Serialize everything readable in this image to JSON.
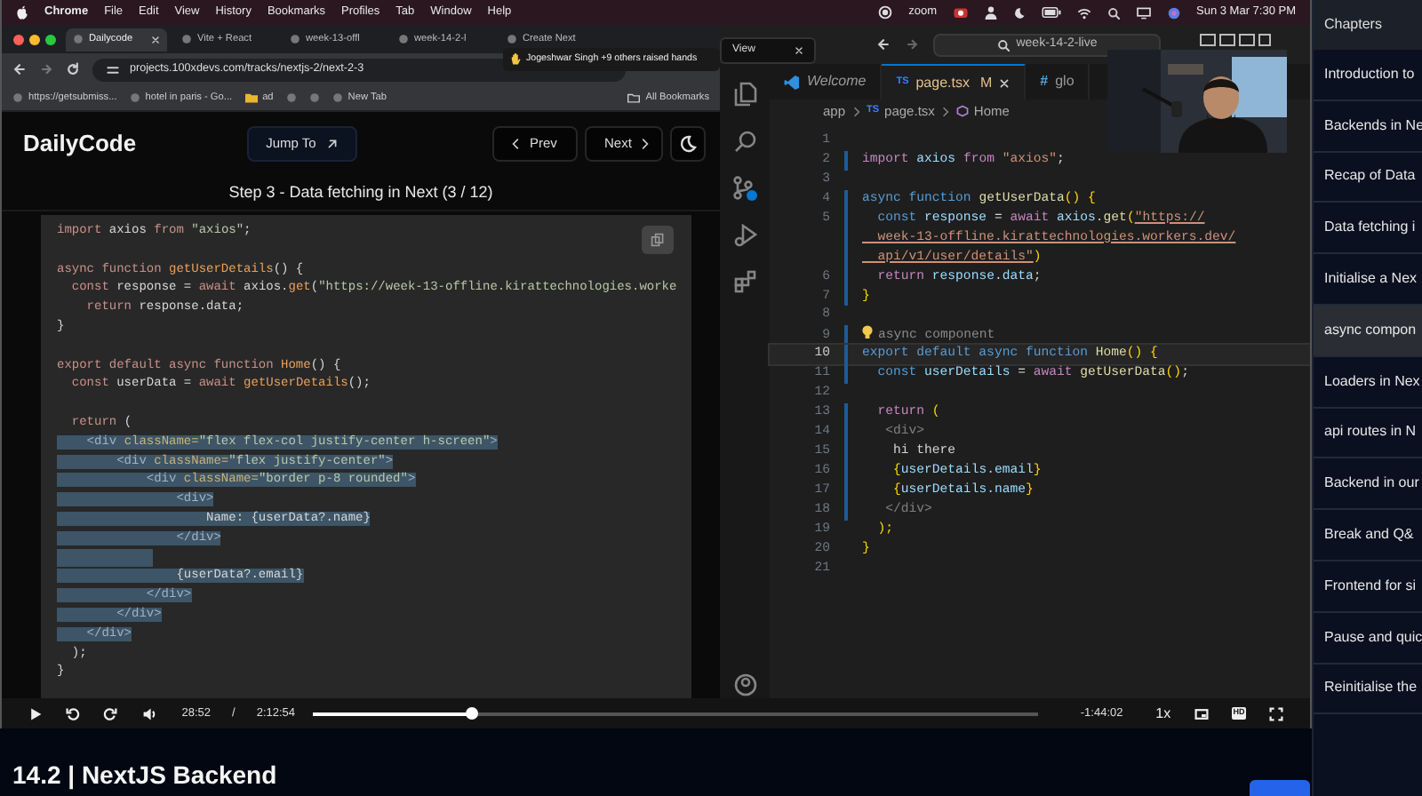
{
  "menubar": {
    "items": [
      "Chrome",
      "File",
      "Edit",
      "View",
      "History",
      "Bookmarks",
      "Profiles",
      "Tab",
      "Window",
      "Help"
    ],
    "app_label": "zoom",
    "clock": "Sun 3 Mar 7:30 PM"
  },
  "browser": {
    "tabs": [
      {
        "label": "Dailycode",
        "selected": true
      },
      {
        "label": "Vite + React",
        "selected": false
      },
      {
        "label": "week-13-offl",
        "selected": false
      },
      {
        "label": "week-14-2-l",
        "selected": false
      },
      {
        "label": "Create Next",
        "selected": false
      }
    ],
    "address": "projects.100xdevs.com/tracks/nextjs-2/next-2-3",
    "bookmarks": [
      {
        "kind": "link",
        "label": "https://getsubmiss..."
      },
      {
        "kind": "link",
        "label": "hotel in paris - Go..."
      },
      {
        "kind": "folder",
        "label": "ad"
      },
      {
        "kind": "icon"
      },
      {
        "kind": "icon"
      },
      {
        "kind": "link",
        "label": "New Tab"
      }
    ],
    "all_bookmarks": "All Bookmarks",
    "notification": "Jogeshwar Singh +9 others raised hands",
    "site": {
      "brand": "DailyCode",
      "jump": "Jump To",
      "prev": "Prev",
      "next": "Next",
      "step": "Step 3 - Data fetching in Next (3 / 12)"
    },
    "code": [
      {
        "selected": false,
        "tokens": [
          {
            "kind": "kw",
            "text": "import "
          },
          {
            "kind": "p",
            "text": "axios "
          },
          {
            "kind": "kw",
            "text": "from "
          },
          {
            "kind": "s",
            "text": "\"axios\""
          },
          {
            "kind": "p",
            "text": ";"
          }
        ]
      },
      {
        "selected": false
      },
      {
        "selected": false,
        "tokens": [
          {
            "kind": "kw",
            "text": "async function "
          },
          {
            "kind": "f",
            "text": "getUserDetails"
          },
          {
            "kind": "p",
            "text": "() {"
          }
        ]
      },
      {
        "selected": false,
        "tokens": [
          {
            "kind": "kw",
            "text": "  const "
          },
          {
            "kind": "p",
            "text": "response = "
          },
          {
            "kind": "kw",
            "text": "await "
          },
          {
            "kind": "p",
            "text": "axios."
          },
          {
            "kind": "f",
            "text": "get"
          },
          {
            "kind": "p",
            "text": "("
          },
          {
            "kind": "s",
            "text": "\"https://week-13-offline.kirattechnologies.worke"
          }
        ]
      },
      {
        "selected": false,
        "tokens": [
          {
            "kind": "kw",
            "text": "    return "
          },
          {
            "kind": "p",
            "text": "response.data;"
          }
        ]
      },
      {
        "selected": false,
        "tokens": [
          {
            "kind": "p",
            "text": "}"
          }
        ]
      },
      {
        "selected": false
      },
      {
        "selected": false,
        "tokens": [
          {
            "kind": "kw",
            "text": "export default async function "
          },
          {
            "kind": "f",
            "text": "Home"
          },
          {
            "kind": "p",
            "text": "() {"
          }
        ]
      },
      {
        "selected": false,
        "tokens": [
          {
            "kind": "kw",
            "text": "  const "
          },
          {
            "kind": "p",
            "text": "userData = "
          },
          {
            "kind": "kw",
            "text": "await "
          },
          {
            "kind": "f",
            "text": "getUserDetails"
          },
          {
            "kind": "p",
            "text": "();"
          }
        ]
      },
      {
        "selected": false
      },
      {
        "selected": false,
        "tokens": [
          {
            "kind": "kw",
            "text": "  return "
          },
          {
            "kind": "p",
            "text": "("
          }
        ]
      },
      {
        "selected": true,
        "tokens": [
          {
            "kind": "t",
            "text": "    <div "
          },
          {
            "kind": "a",
            "text": "className="
          },
          {
            "kind": "s",
            "text": "\"flex flex-col justify-center h-screen\""
          },
          {
            "kind": "t",
            "text": ">"
          }
        ]
      },
      {
        "selected": true,
        "tokens": [
          {
            "kind": "t",
            "text": "        <div "
          },
          {
            "kind": "a",
            "text": "className="
          },
          {
            "kind": "s",
            "text": "\"flex justify-center\""
          },
          {
            "kind": "t",
            "text": ">"
          }
        ]
      },
      {
        "selected": true,
        "tokens": [
          {
            "kind": "t",
            "text": "            <div "
          },
          {
            "kind": "a",
            "text": "className="
          },
          {
            "kind": "s",
            "text": "\"border p-8 rounded\""
          },
          {
            "kind": "t",
            "text": ">"
          }
        ]
      },
      {
        "selected": true,
        "tokens": [
          {
            "kind": "t",
            "text": "                <div>"
          }
        ]
      },
      {
        "selected": true,
        "tokens": [
          {
            "kind": "p",
            "text": "                    Name: {userData?.name}"
          }
        ]
      },
      {
        "selected": true,
        "tokens": [
          {
            "kind": "t",
            "text": "                </div>"
          }
        ]
      },
      {
        "selected": true
      },
      {
        "selected": true,
        "tokens": [
          {
            "kind": "p",
            "text": "                {userData?.email}"
          }
        ]
      },
      {
        "selected": true,
        "tokens": [
          {
            "kind": "t",
            "text": "            </div>"
          }
        ]
      },
      {
        "selected": true,
        "tokens": [
          {
            "kind": "t",
            "text": "        </div>"
          }
        ]
      },
      {
        "selected": true,
        "tokens": [
          {
            "kind": "t",
            "text": "    </div>"
          }
        ]
      },
      {
        "selected": false,
        "tokens": [
          {
            "kind": "p",
            "text": "  );"
          }
        ]
      },
      {
        "selected": false,
        "tokens": [
          {
            "kind": "p",
            "text": "}"
          }
        ]
      }
    ]
  },
  "vscode": {
    "tooltip": "View",
    "search": "week-14-2-live",
    "tabs": [
      {
        "kind": "welcome",
        "label": "Welcome",
        "selected": false
      },
      {
        "kind": "file",
        "icon_text": "TS",
        "label": "page.tsx",
        "badge": "M",
        "selected": true
      },
      {
        "kind": "file",
        "icon_text": "#",
        "label": "glo",
        "selected": false
      }
    ],
    "breadcrumb": [
      {
        "kind": "folder",
        "label": "app"
      },
      {
        "kind": "file",
        "icon_text": "TS",
        "label": "page.tsx"
      },
      {
        "kind": "symbol",
        "label": "Home"
      }
    ],
    "lines": [
      {
        "n": "1",
        "changed": false,
        "current": false
      },
      {
        "n": "2",
        "changed": true,
        "current": false,
        "tokens": [
          {
            "kind": "ctl",
            "text": "import "
          },
          {
            "kind": "var",
            "text": "axios "
          },
          {
            "kind": "ctl",
            "text": "from "
          },
          {
            "kind": "str",
            "text": "\"axios\""
          },
          {
            "kind": "p",
            "text": ";"
          }
        ]
      },
      {
        "n": "3",
        "changed": false,
        "current": false
      },
      {
        "n": "4",
        "changed": true,
        "current": false,
        "tokens": [
          {
            "kind": "kw",
            "text": "async function "
          },
          {
            "kind": "fn",
            "text": "getUserData"
          },
          {
            "kind": "br",
            "text": "() {"
          }
        ]
      },
      {
        "n": "5",
        "changed": true,
        "current": false,
        "tokens": [
          {
            "kind": "kw",
            "text": "  const "
          },
          {
            "kind": "var",
            "text": "response "
          },
          {
            "kind": "p",
            "text": "= "
          },
          {
            "kind": "ctl",
            "text": "await "
          },
          {
            "kind": "var",
            "text": "axios"
          },
          {
            "kind": "p",
            "text": "."
          },
          {
            "kind": "fn",
            "text": "get"
          },
          {
            "kind": "br",
            "text": "("
          },
          {
            "kind": "url",
            "text": "\"https://"
          }
        ]
      },
      {
        "changed": true,
        "current": false,
        "tokens": [
          {
            "kind": "url",
            "text": "  week-13-offline.kirattechnologies.workers.dev/"
          }
        ]
      },
      {
        "changed": true,
        "current": false,
        "tokens": [
          {
            "kind": "url",
            "text": "  api/v1/user/details\""
          },
          {
            "kind": "br",
            "text": ")"
          }
        ]
      },
      {
        "n": "6",
        "changed": true,
        "current": false,
        "tokens": [
          {
            "kind": "ctl",
            "text": "  return "
          },
          {
            "kind": "var",
            "text": "response"
          },
          {
            "kind": "p",
            "text": "."
          },
          {
            "kind": "var",
            "text": "data"
          },
          {
            "kind": "p",
            "text": ";"
          }
        ]
      },
      {
        "n": "7",
        "changed": true,
        "current": false,
        "tokens": [
          {
            "kind": "br",
            "text": "}"
          }
        ]
      },
      {
        "n": "8",
        "changed": false,
        "current": false
      },
      {
        "n": "9",
        "changed": true,
        "current": false,
        "tokens": [
          {
            "kind": "hint",
            "text": "async component"
          }
        ]
      },
      {
        "n": "10",
        "changed": true,
        "current": true,
        "tokens": [
          {
            "kind": "kw",
            "text": "export default async function "
          },
          {
            "kind": "fn",
            "text": "Home"
          },
          {
            "kind": "br",
            "text": "() {"
          }
        ]
      },
      {
        "n": "11",
        "changed": true,
        "current": false,
        "tokens": [
          {
            "kind": "kw",
            "text": "  const "
          },
          {
            "kind": "var",
            "text": "userDetails "
          },
          {
            "kind": "p",
            "text": "= "
          },
          {
            "kind": "ctl",
            "text": "await "
          },
          {
            "kind": "fn",
            "text": "getUserData"
          },
          {
            "kind": "br",
            "text": "()"
          },
          {
            "kind": "p",
            "text": ";"
          }
        ]
      },
      {
        "n": "12",
        "changed": false,
        "current": false
      },
      {
        "n": "13",
        "changed": true,
        "current": false,
        "tokens": [
          {
            "kind": "ctl",
            "text": "  return "
          },
          {
            "kind": "br",
            "text": "("
          }
        ]
      },
      {
        "n": "14",
        "changed": true,
        "current": false,
        "tokens": [
          {
            "kind": "tag",
            "text": "   <div>"
          }
        ]
      },
      {
        "n": "15",
        "changed": true,
        "current": false,
        "tokens": [
          {
            "kind": "p",
            "text": "    hi there"
          }
        ]
      },
      {
        "n": "16",
        "changed": true,
        "current": false,
        "tokens": [
          {
            "kind": "br",
            "text": "    {"
          },
          {
            "kind": "var",
            "text": "userDetails.email"
          },
          {
            "kind": "br",
            "text": "}"
          }
        ]
      },
      {
        "n": "17",
        "changed": true,
        "current": false,
        "tokens": [
          {
            "kind": "br",
            "text": "    {"
          },
          {
            "kind": "var",
            "text": "userDetails.name"
          },
          {
            "kind": "br",
            "text": "}"
          }
        ]
      },
      {
        "n": "18",
        "changed": true,
        "current": false,
        "tokens": [
          {
            "kind": "tag",
            "text": "   </div>"
          }
        ]
      },
      {
        "n": "19",
        "changed": false,
        "current": false,
        "tokens": [
          {
            "kind": "br",
            "text": "  );"
          }
        ]
      },
      {
        "n": "20",
        "changed": false,
        "current": false,
        "tokens": [
          {
            "kind": "br",
            "text": "}"
          }
        ]
      },
      {
        "n": "21",
        "changed": false,
        "current": false
      }
    ]
  },
  "player": {
    "current": "28:52",
    "separator": "/",
    "duration": "2:12:54",
    "level": 0.22,
    "remaining": "-1:44:02",
    "speed": "1x",
    "quality": "HD"
  },
  "title": "14.2 | NextJS Backend",
  "chapters": {
    "title": "Chapters",
    "items": [
      {
        "label": "Introduction to",
        "selected": false
      },
      {
        "label": "Backends in Ne",
        "selected": false
      },
      {
        "label": "Recap of Data",
        "selected": false
      },
      {
        "label": "Data fetching i",
        "selected": false
      },
      {
        "label": "Initialise a Nex",
        "selected": false
      },
      {
        "label": "async compon",
        "selected": true
      },
      {
        "label": "Loaders in Nex",
        "selected": false
      },
      {
        "label": "api routes in N",
        "selected": false
      },
      {
        "label": "Backend in our",
        "selected": false
      },
      {
        "label": "Break and Q&",
        "selected": false
      },
      {
        "label": "Frontend for si",
        "selected": false
      },
      {
        "label": "Pause and quic",
        "selected": false
      },
      {
        "label": "Reinitialise the",
        "selected": false
      }
    ]
  }
}
